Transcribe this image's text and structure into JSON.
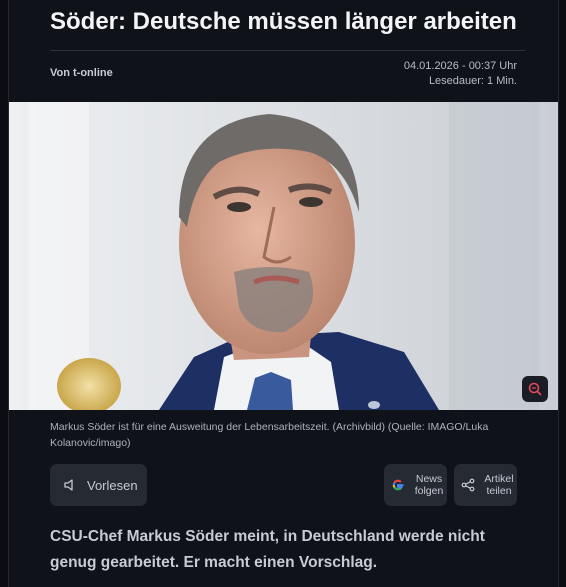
{
  "article": {
    "title": "Söder: Deutsche müssen länger arbeiten",
    "author": "Von t-online",
    "date": "04.01.2026 - 00:37 Uhr",
    "reading_time": "Lesedauer: 1 Min.",
    "caption": "Markus Söder ist für eine Ausweitung der Lebensarbeitszeit. (Archivbild) (Quelle: IMAGO/Luka Kolanovic/imago)",
    "lead": "CSU-Chef Markus Söder meint, in Deutschland werde nicht genug gearbeitet. Er macht einen Vorschlag."
  },
  "actions": {
    "read_aloud": "Vorlesen",
    "news_line1": "News",
    "news_line2": "folgen",
    "share_line1": "Artikel",
    "share_line2": "teilen"
  },
  "icons": {
    "zoom": "zoom-icon",
    "speaker": "speaker-icon",
    "google": "google-icon",
    "share": "share-icon"
  },
  "colors": {
    "background": "#0f1219",
    "button": "#252a33",
    "title": "#f3f4f7"
  }
}
